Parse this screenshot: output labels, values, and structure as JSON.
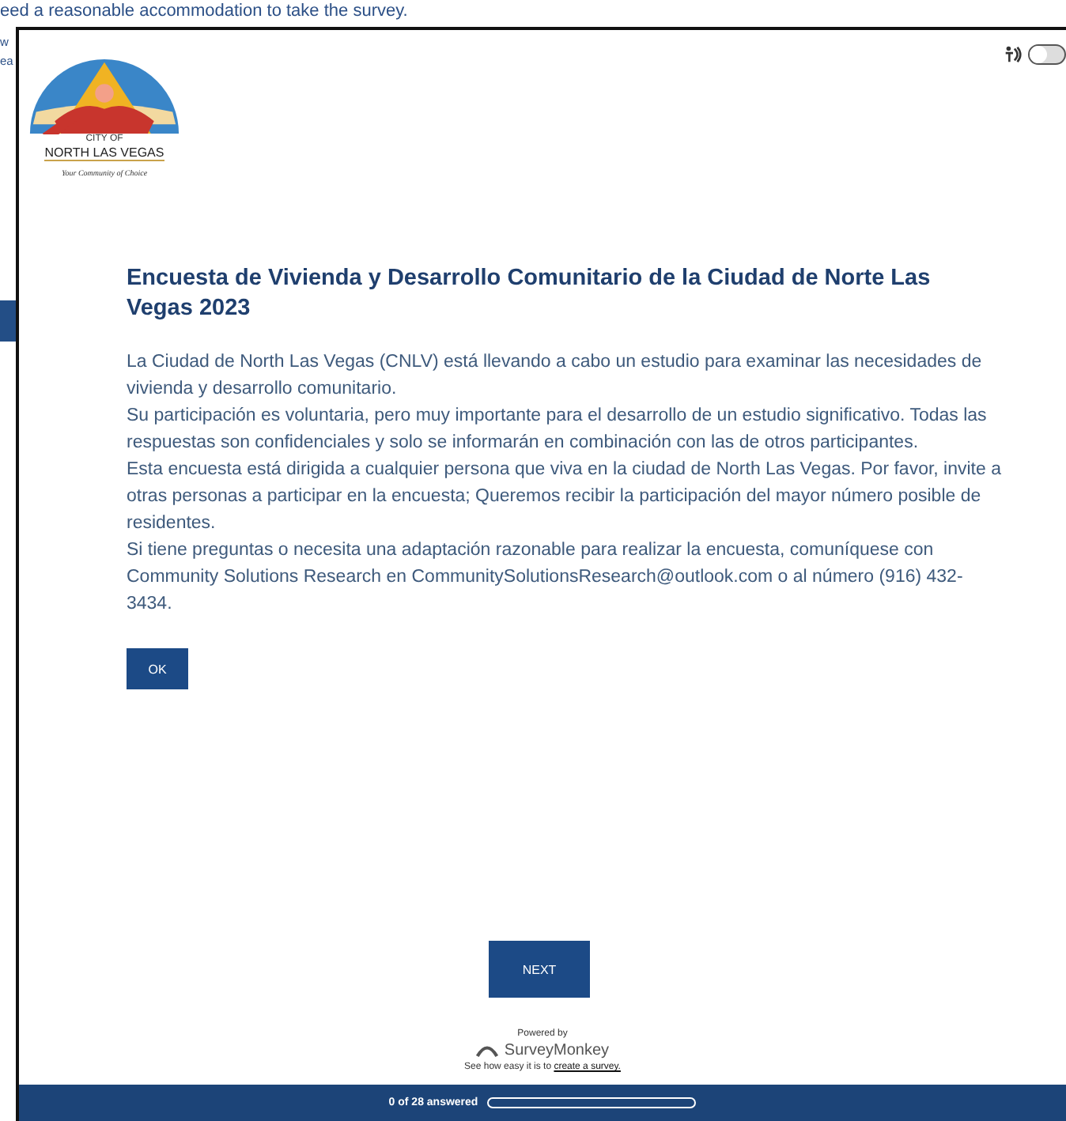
{
  "background_page": {
    "top_text": "eed a reasonable accommodation to take the survey.",
    "side_fragments": [
      "w",
      "ea"
    ]
  },
  "logo": {
    "city_of": "CITY OF",
    "city_name": "NORTH LAS VEGAS",
    "tagline": "Your Community of Choice"
  },
  "accessibility_toggle": {
    "on": false
  },
  "title": "Encuesta de Vivienda y Desarrollo Comunitario de la Ciudad de Norte Las Vegas 2023",
  "paragraphs": [
    "La Ciudad de North Las Vegas (CNLV) está llevando a cabo un estudio para examinar las necesidades de vivienda y desarrollo comunitario.",
    "Su participación es voluntaria, pero muy importante para el desarrollo de un estudio significativo. Todas las respuestas son confidenciales y solo se informarán en combinación con las de otros participantes.",
    "Esta encuesta está dirigida a cualquier persona que viva en la ciudad de North Las Vegas. Por favor, invite a otras personas a participar en la encuesta; Queremos recibir la participación del mayor número posible de residentes.",
    "Si tiene preguntas o necesita una adaptación razonable para realizar la encuesta, comuníquese con Community Solutions Research en CommunitySolutionsResearch@outlook.com o al número (916) 432-3434."
  ],
  "ok_button": "OK",
  "next_button": "NEXT",
  "powered": {
    "label": "Powered by",
    "brand": "SurveyMonkey",
    "note": "See how easy it is to",
    "link": "create a survey."
  },
  "progress": {
    "text": "0 of 28 answered",
    "level": 0
  }
}
